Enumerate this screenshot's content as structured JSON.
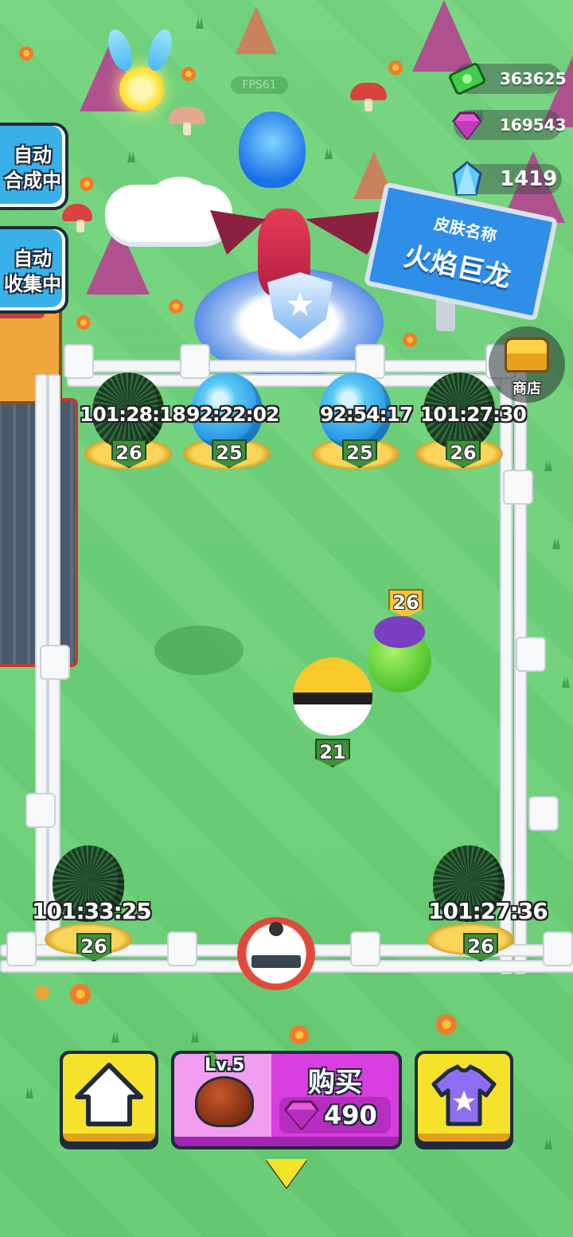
{
  "hud": {
    "fps": "FPS61",
    "currencies": [
      {
        "name": "cash",
        "value": "363625",
        "icon": "cash-icon"
      },
      {
        "name": "pink-gem",
        "value": "169543",
        "icon": "pink-gem-icon"
      },
      {
        "name": "blue-crystal",
        "value": "1419",
        "icon": "blue-crystal-icon"
      }
    ]
  },
  "side_buttons": {
    "auto_merge": [
      "自动",
      "合成中"
    ],
    "auto_collect": [
      "自动",
      "收集中"
    ]
  },
  "sign": {
    "title": "皮肤名称",
    "skin_name": "火焰巨龙"
  },
  "shop": {
    "label": "商店"
  },
  "eggs": [
    {
      "timer": "101:28:18",
      "level": "26",
      "type": "dark"
    },
    {
      "timer": "92:22:02",
      "level": "25",
      "type": "blue"
    },
    {
      "timer": "92:54:17",
      "level": "25",
      "type": "blue"
    },
    {
      "timer": "101:27:30",
      "level": "26",
      "type": "dark"
    },
    {
      "timer": "101:33:25",
      "level": "26",
      "type": "dark"
    },
    {
      "timer": "101:27:36",
      "level": "26",
      "type": "dark"
    }
  ],
  "creatures": [
    {
      "name": "green-slime",
      "level": "26"
    },
    {
      "name": "yellow-ball",
      "level": "21"
    }
  ],
  "bottom_bar": {
    "buy_level": "Lv.5",
    "buy_label": "购买",
    "buy_price": "490"
  },
  "colors": {
    "grass": "#6fd07a",
    "accent_yellow": "#f5e22a",
    "buy_magenta": "#d93ee0",
    "side_button_blue": "#38b0e8",
    "sign_blue": "#2f8ee8"
  }
}
